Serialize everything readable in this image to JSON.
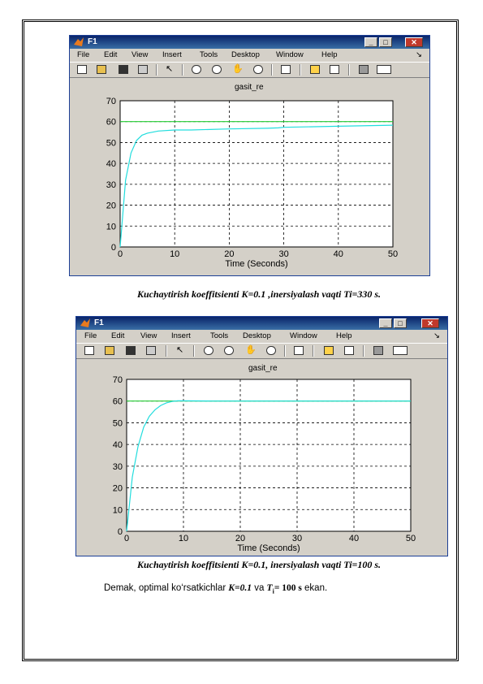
{
  "window_title": "F1",
  "menu": [
    "File",
    "Edit",
    "View",
    "Insert",
    "Tools",
    "Desktop",
    "Window",
    "Help"
  ],
  "captions": [
    "Kuchaytirish koeffitsienti K=0.1 ,inersiyalash vaqti Ti=330 s.",
    "Kuchaytirish koeffitsienti K=0.1, inersiyalash vaqti Ti=100 s."
  ],
  "conclusion": {
    "prefix": "Demak, optimal ko‘rsatkichlar ",
    "k": "K=0.1",
    "and": " va ",
    "ti_symbol": "T",
    "ti_sub": "i",
    "ti_value": "= 100 s",
    "suffix": " ekan."
  },
  "colors": {
    "setpoint": "#22cc33",
    "response": "#22dddd",
    "window_border": "#1c3f95"
  },
  "chart_data": [
    {
      "type": "line",
      "title": "gasit_re",
      "xlabel": "Time (Seconds)",
      "ylabel": "",
      "xlim": [
        0,
        50
      ],
      "ylim": [
        0,
        70
      ],
      "x_ticks": [
        0,
        10,
        20,
        30,
        40,
        50
      ],
      "y_ticks": [
        0,
        10,
        20,
        30,
        40,
        50,
        60,
        70
      ],
      "grid": true,
      "series": [
        {
          "color": "#22cc33",
          "x": [
            0,
            50
          ],
          "y": [
            60,
            60
          ]
        },
        {
          "color": "#22dddd",
          "x": [
            0,
            1,
            2,
            3,
            4,
            5,
            7,
            10,
            13,
            20,
            27,
            29,
            30,
            40,
            50
          ],
          "y": [
            0,
            32,
            45,
            51,
            53.5,
            54.5,
            55.5,
            56,
            56,
            56.5,
            56.8,
            57,
            57.3,
            57.8,
            58.3
          ]
        }
      ]
    },
    {
      "type": "line",
      "title": "gasit_re",
      "xlabel": "Time (Seconds)",
      "ylabel": "",
      "xlim": [
        0,
        50
      ],
      "ylim": [
        0,
        70
      ],
      "x_ticks": [
        0,
        10,
        20,
        30,
        40,
        50
      ],
      "y_ticks": [
        0,
        10,
        20,
        30,
        40,
        50,
        60,
        70
      ],
      "grid": true,
      "series": [
        {
          "color": "#22cc33",
          "x": [
            0,
            50
          ],
          "y": [
            60,
            60
          ]
        },
        {
          "color": "#22dddd",
          "x": [
            0,
            1,
            2,
            3,
            4,
            5,
            6,
            7,
            8,
            9,
            10,
            15,
            20,
            30,
            50
          ],
          "y": [
            0,
            25,
            39,
            48,
            53,
            56,
            58,
            59.2,
            59.8,
            60.1,
            60.1,
            60,
            60,
            60,
            60
          ]
        }
      ]
    }
  ]
}
